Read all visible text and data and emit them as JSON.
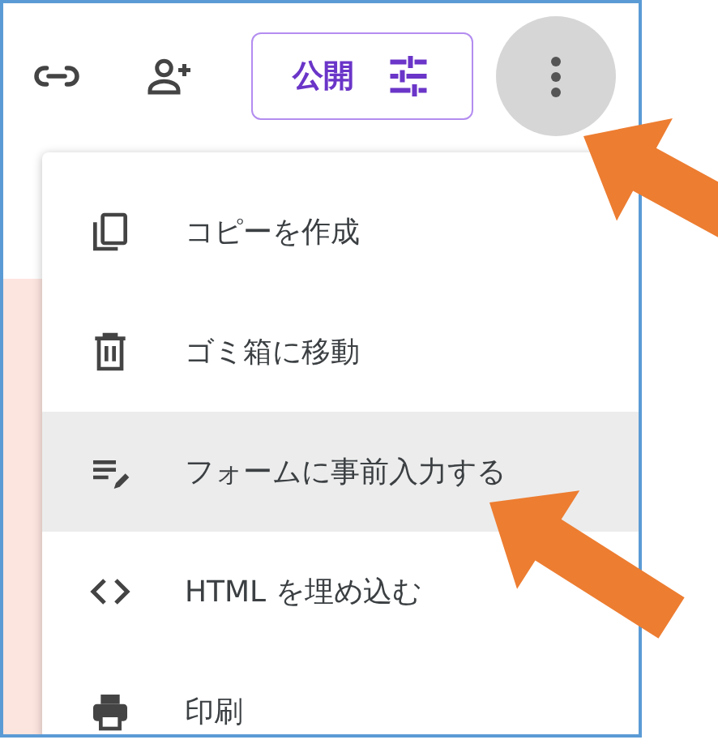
{
  "toolbar": [
    {
      "kind": "link"
    },
    {
      "kind": "add-person"
    },
    {
      "kind": "publish",
      "label": "公開"
    },
    {
      "kind": "more",
      "selected": true
    }
  ],
  "menu": [
    {
      "kind": "copy",
      "label": "コピーを作成",
      "selected": false
    },
    {
      "kind": "trash",
      "label": "ゴミ箱に移動",
      "selected": false
    },
    {
      "kind": "prefill",
      "label": "フォームに事前入力する",
      "selected": true
    },
    {
      "kind": "embed",
      "label": "HTML を埋め込む",
      "selected": false
    },
    {
      "kind": "print",
      "label": "印刷",
      "selected": false
    }
  ]
}
